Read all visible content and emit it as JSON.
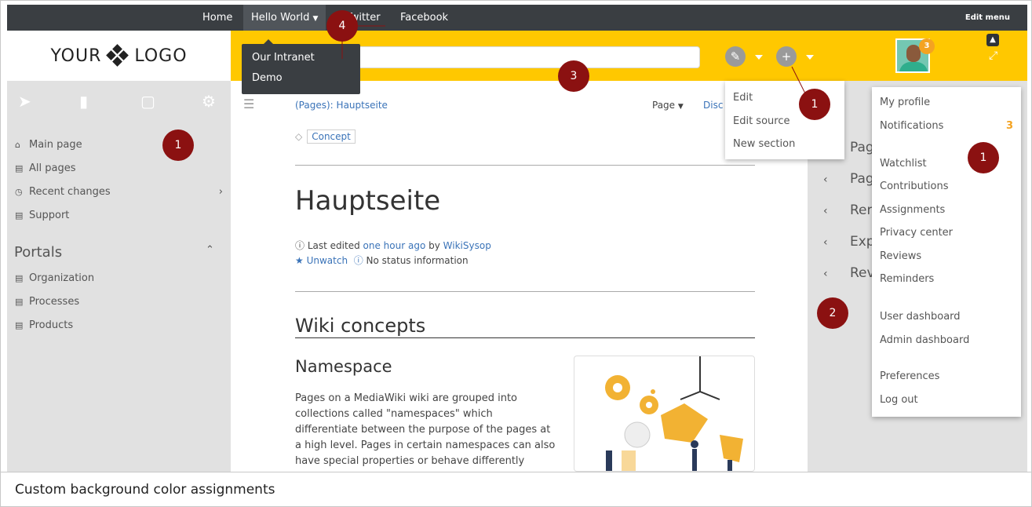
{
  "topnav": {
    "items": [
      "Home",
      "Hello World",
      "Twitter",
      "Facebook"
    ],
    "active_index": 1,
    "edit_menu": "Edit menu"
  },
  "hello_world_menu": [
    "Our Intranet",
    "Demo"
  ],
  "logo": {
    "text_left": "YOUR",
    "text_right": "LOGO"
  },
  "header": {
    "notification_count": "3"
  },
  "sidebar": {
    "items": [
      {
        "label": "Main page",
        "icon": "home-icon"
      },
      {
        "label": "All pages",
        "icon": "list-icon"
      },
      {
        "label": "Recent changes",
        "icon": "clock-icon"
      },
      {
        "label": "Support",
        "icon": "list-icon"
      }
    ],
    "portals_title": "Portals",
    "portals": [
      "Organization",
      "Processes",
      "Products"
    ]
  },
  "content": {
    "breadcrumb_prefix": "(Pages):",
    "breadcrumb_page": "Hauptseite",
    "tab_page": "Page",
    "tab_discussion": "Disc",
    "tag": "Concept",
    "title": "Hauptseite",
    "last_edited_prefix": "Last edited",
    "last_edited_time": "one hour ago",
    "last_edited_by": "by",
    "last_edited_user": "WikiSysop",
    "unwatch": "Unwatch",
    "status": "No status information",
    "section_title": "Wiki concepts",
    "subsection_title": "Namespace",
    "paragraph": "Pages on a MediaWiki wiki are grouped into collections called \"namespaces\" which differentiate between the purpose of the pages at a high level. Pages in certain namespaces can also have special properties or behave differently"
  },
  "edit_menu_dd": [
    "Edit",
    "Edit source",
    "New section"
  ],
  "right_panel": [
    "Pag",
    "Pag",
    "Rer",
    "Exp",
    "Rev"
  ],
  "user_menu": {
    "items": [
      "My profile",
      "Notifications",
      "Watchlist",
      "Contributions",
      "Assignments",
      "Privacy center",
      "Reviews",
      "Reminders",
      "User dashboard",
      "Admin dashboard",
      "Preferences",
      "Log out"
    ],
    "notifications_count": "3"
  },
  "callouts": [
    "1",
    "1",
    "1",
    "2",
    "3",
    "4"
  ],
  "caption": "Custom background color assignments",
  "colors": {
    "header": "#ffc800",
    "topbar": "#3a3e42",
    "sidebar": "#e1e1e1",
    "callout": "#8b1111",
    "link": "#3a73b8"
  }
}
